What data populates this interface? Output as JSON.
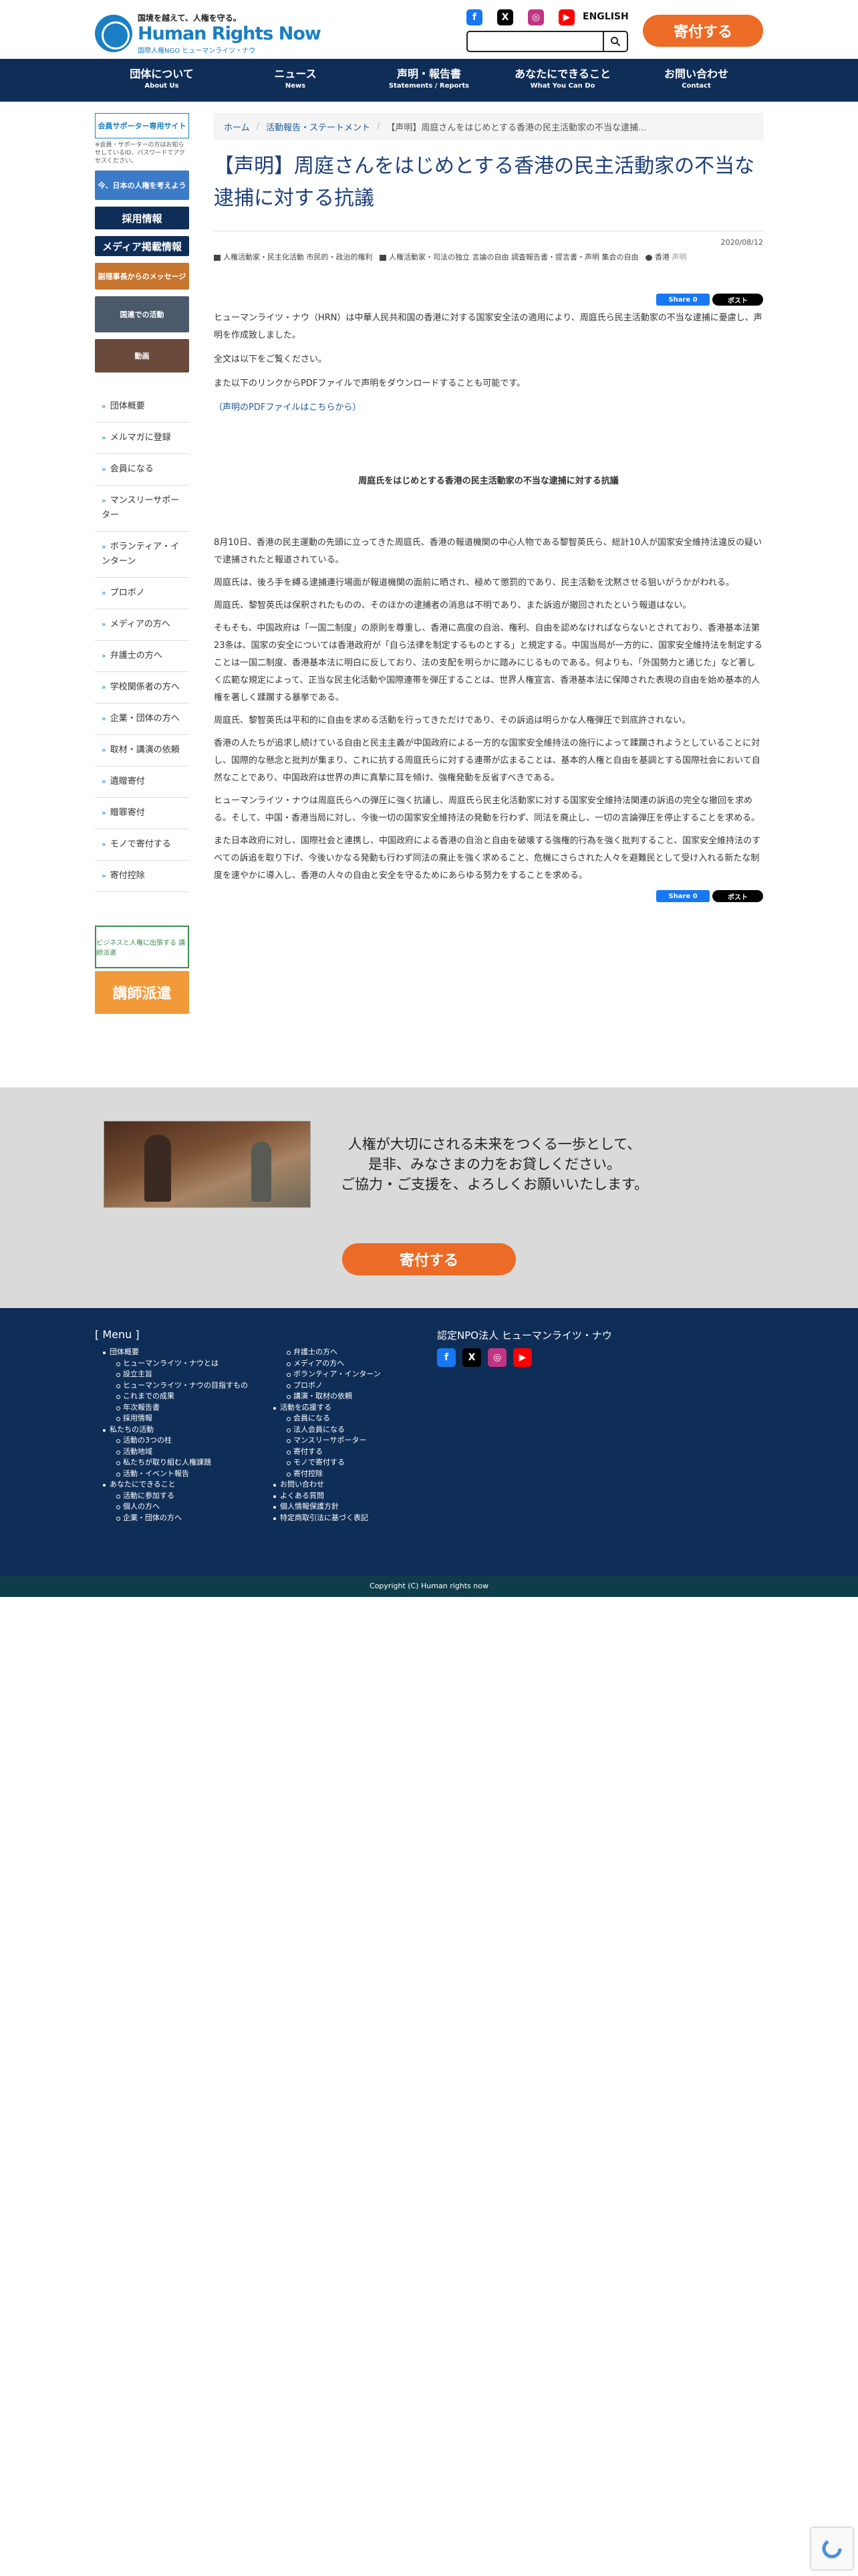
{
  "header": {
    "logo_tagline": "国境を越えて、人権を守る。",
    "logo_name": "Human Rights Now",
    "logo_sub": "国際人権NGO ヒューマンライツ・ナウ",
    "social": [
      {
        "icon": "facebook-icon",
        "color": "#1877f2",
        "glyph": "f"
      },
      {
        "icon": "x-icon",
        "color": "#000000",
        "glyph": "X"
      },
      {
        "icon": "instagram-icon",
        "color": "#c13584",
        "glyph": "◎"
      },
      {
        "icon": "youtube-icon",
        "color": "#ff0000",
        "glyph": "▶"
      }
    ],
    "english": "ENGLISH",
    "search_placeholder": "",
    "donate": "寄付する"
  },
  "nav": [
    {
      "ja": "団体について",
      "en": "About Us"
    },
    {
      "ja": "ニュース",
      "en": "News"
    },
    {
      "ja": "声明・報告書",
      "en": "Statements / Reports"
    },
    {
      "ja": "あなたにできること",
      "en": "What You Can Do"
    },
    {
      "ja": "お問い合わせ",
      "en": "Contact"
    }
  ],
  "sidebar": {
    "supporter_box": "会員サポーター専用サイト",
    "supporter_note": "※会員・サポーターの方はお知らせしているID、パスワードでアクセスください。",
    "banners": [
      {
        "label": "今、日本の人権を考えよう",
        "color": "#3b7bc8"
      },
      {
        "label": "採用情報",
        "color": "#0f2e57"
      },
      {
        "label": "メディア掲載情報",
        "color": "#0f2e57"
      },
      {
        "label": "副理事長からのメッセージ",
        "color": "#c8762f"
      },
      {
        "label": "国連での活動",
        "color": "#4a5a6a"
      },
      {
        "label": "動画",
        "color": "#6a4a3a"
      }
    ],
    "nav": [
      "団体概要",
      "メルマガに登録",
      "会員になる",
      "マンスリーサポーター",
      "ボランティア・インターン",
      "プロボノ",
      "メディアの方へ",
      "弁護士の方へ",
      "学校関係者の方へ",
      "企業・団体の方へ",
      "取材・講演の依頼",
      "遺贈寄付",
      "贈罪寄付",
      "モノで寄付する",
      "寄付控除"
    ],
    "promo1": "ビジネスと人権に出張する 講師派遣",
    "promo2": "講師派遣"
  },
  "breadcrumb": {
    "home": "ホーム",
    "section": "活動報告・ステートメント",
    "current": "【声明】周庭さんをはじめとする香港の民主活動家の不当な逮捕..."
  },
  "article": {
    "title": "【声明】周庭さんをはじめとする香港の民主活動家の不当な逮捕に対する抗議",
    "date": "2020/08/12",
    "categories": "人権活動家・民主化活動 市民的・政治的権利",
    "tags": "人権活動家・司法の独立 言論の自由 調査報告書・提言書・声明 集会の自由",
    "region": "香港",
    "type_label": "声明",
    "share_fb": "Share 0",
    "share_x": "ポスト",
    "intro": "ヒューマンライツ・ナウ（HRN）は中華人民共和国の香港に対する国家安全法の適用により、周庭氏ら民主活動家の不当な逮捕に憂慮し、声明を作成致しました。",
    "p2": "全文は以下をご覧ください。",
    "p3": "また以下のリンクからPDFファイルで声明をダウンロードすることも可能です。",
    "pdf_link": "（声明のPDFファイルはこちらから）",
    "statement_title": "周庭氏をはじめとする香港の民主活動家の不当な逮捕に対する抗議",
    "paragraphs": [
      "8月10日、香港の民主運動の先頭に立ってきた周庭氏、香港の報道機関の中心人物である黎智英氏ら、総計10人が国家安全維持法違反の疑いで逮捕されたと報道されている。",
      "周庭氏は、後ろ手を縛る逮捕連行場面が報道機関の面前に晒され、極めて懲罰的であり、民主活動を沈黙させる狙いがうかがわれる。",
      "周庭氏、黎智英氏は保釈されたものの、そのほかの逮捕者の消息は不明であり、また訴追が撤回されたという報道はない。",
      "そもそも、中国政府は「一国二制度」の原則を尊重し、香港に高度の自治、権利、自由を認めなければならないとされており、香港基本法第23条は、国家の安全については香港政府が「自ら法律を制定するものとする」と規定する。中国当局が一方的に、国家安全維持法を制定することは一国二制度、香港基本法に明白に反しており、法の支配を明らかに踏みにじるものである。何よりも、「外国勢力と通じた」など著しく広範な規定によって、正当な民主化活動や国際連帯を弾圧することは、世界人権宣言、香港基本法に保障された表現の自由を始め基本的人権を著しく蹂躙する暴挙である。",
      "周庭氏、黎智英氏は平和的に自由を求める活動を行ってきただけであり、その訴追は明らかな人権弾圧で到底許されない。",
      "香港の人たちが追求し続けている自由と民主主義が中国政府による一方的な国家安全維持法の施行によって蹂躙されようとしていることに対し、国際的な懸念と批判が集まり、これに抗する周庭氏らに対する連帯が広まることは、基本的人権と自由を基調とする国際社会において自然なことであり、中国政府は世界の声に真摯に耳を傾け、強権発動を反省すべきである。",
      "ヒューマンライツ・ナウは周庭氏らへの弾圧に強く抗議し、周庭氏ら民主化活動家に対する国家安全維持法関連の訴追の完全な撤回を求める。そして、中国・香港当局に対し、今後一切の国家安全維持法の発動を行わず、同法を廃止し、一切の言論弾圧を停止することを求める。",
      "また日本政府に対し、国際社会と連携し、中国政府による香港の自治と自由を破壊する強権的行為を強く批判すること、国家安全維持法のすべての訴追を取り下げ、今後いかなる発動も行わず同法の廃止を強く求めること、危機にさらされた人々を避難民として受け入れる新たな制度を速やかに導入し、香港の人々の自由と安全を守るためにあらゆる努力をすることを求める。"
    ]
  },
  "cta": {
    "line1": "人権が大切にされる未来をつくる一歩として、",
    "line2": "是非、みなさまの力をお貸しください。",
    "line3": "ご協力・ご支援を、よろしくお願いいたします。",
    "button": "寄付する"
  },
  "footer": {
    "menu_title": "[ Menu ]",
    "col1": [
      {
        "t": "団体概要",
        "l": 1
      },
      {
        "t": "ヒューマンライツ・ナウとは",
        "l": 2
      },
      {
        "t": "設立主旨",
        "l": 2
      },
      {
        "t": "ヒューマンライツ・ナウの目指すもの",
        "l": 2
      },
      {
        "t": "これまでの成果",
        "l": 2
      },
      {
        "t": "年次報告書",
        "l": 2
      },
      {
        "t": "採用情報",
        "l": 2
      },
      {
        "t": "私たちの活動",
        "l": 1
      },
      {
        "t": "活動の3つの柱",
        "l": 2
      },
      {
        "t": "活動地域",
        "l": 2
      },
      {
        "t": "私たちが取り組む人権課題",
        "l": 2
      },
      {
        "t": "活動・イベント報告",
        "l": 2
      },
      {
        "t": "あなたにできること",
        "l": 1
      },
      {
        "t": "活動に参加する",
        "l": 2
      },
      {
        "t": "個人の方へ",
        "l": 2
      },
      {
        "t": "企業・団体の方へ",
        "l": 2
      }
    ],
    "col2": [
      {
        "t": "弁護士の方へ",
        "l": 2
      },
      {
        "t": "メディアの方へ",
        "l": 2
      },
      {
        "t": "ボランティア・インターン",
        "l": 2
      },
      {
        "t": "プロボノ",
        "l": 2
      },
      {
        "t": "講演・取材の依頼",
        "l": 2
      },
      {
        "t": "活動を応援する",
        "l": 1
      },
      {
        "t": "会員になる",
        "l": 2
      },
      {
        "t": "法人会員になる",
        "l": 2
      },
      {
        "t": "マンスリーサポーター",
        "l": 2
      },
      {
        "t": "寄付する",
        "l": 2
      },
      {
        "t": "モノで寄付する",
        "l": 2
      },
      {
        "t": "寄付控除",
        "l": 2
      },
      {
        "t": "お問い合わせ",
        "l": 1
      },
      {
        "t": "よくある質問",
        "l": 1
      },
      {
        "t": "個人情報保護方針",
        "l": 1
      },
      {
        "t": "特定商取引法に基づく表記",
        "l": 1
      }
    ],
    "org": "認定NPO法人 ヒューマンライツ・ナウ",
    "copyright": "Copyright (C) Human rights now"
  }
}
